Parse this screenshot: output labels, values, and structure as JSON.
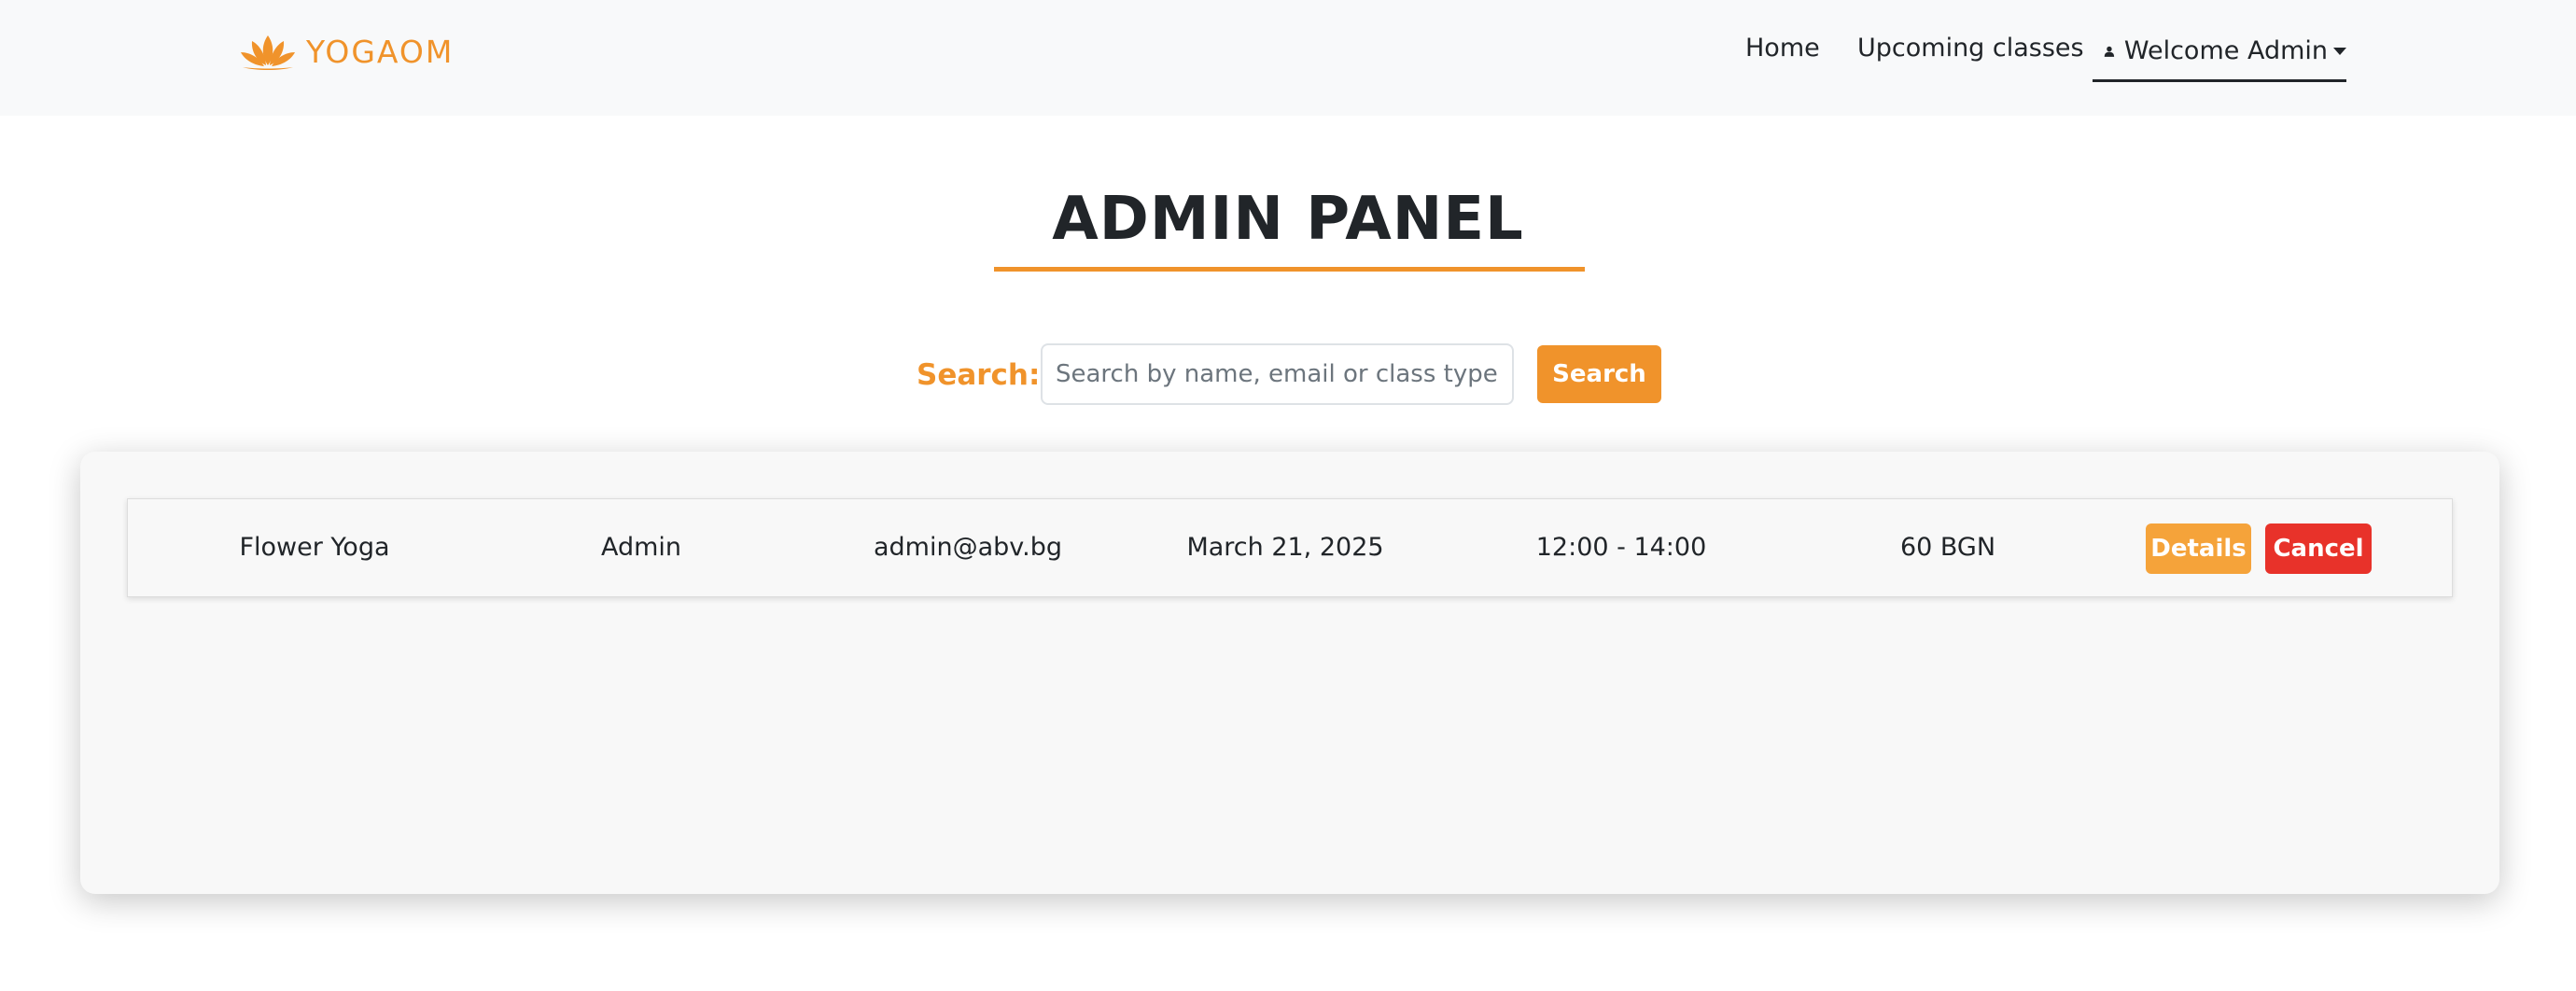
{
  "colors": {
    "accent": "#f0932b",
    "details": "#f5a33a",
    "cancel": "#e8322a",
    "navbar_bg": "#f8f9fa",
    "card_bg": "#f8f8f8"
  },
  "navbar": {
    "brand": "YOGAOM",
    "brand_icon": "lotus-icon",
    "links": [
      {
        "label": "Home"
      },
      {
        "label": "Upcoming classes"
      }
    ],
    "user_menu": {
      "icon": "user-icon",
      "label": "Welcome Admin"
    }
  },
  "page": {
    "title": "ADMIN PANEL"
  },
  "search": {
    "label": "Search:",
    "placeholder": "Search by name, email or class type...",
    "value": "",
    "button_label": "Search"
  },
  "bookings": [
    {
      "class_name": "Flower Yoga",
      "user": "Admin",
      "email": "admin@abv.bg",
      "date": "March 21, 2025",
      "time": "12:00 - 14:00",
      "price": "60 BGN",
      "details_label": "Details",
      "cancel_label": "Cancel"
    }
  ]
}
